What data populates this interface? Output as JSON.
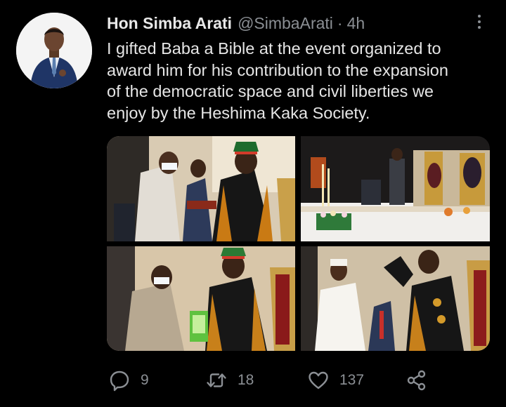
{
  "tweet": {
    "author_name": "Hon Simba Arati",
    "handle": "@SimbaArati",
    "separator": "·",
    "time": "4h",
    "text_lines": [
      "I gifted Baba a Bible at the event organized to",
      "award him for his contribution to the expansion",
      "of the democratic space and civil liberties we",
      "enjoy by the Heshima Kaka Society."
    ]
  },
  "media": {
    "photo_count": 4
  },
  "actions": {
    "reply": {
      "icon": "reply-icon",
      "count": "9"
    },
    "retweet": {
      "icon": "retweet-icon",
      "count": "18"
    },
    "like": {
      "icon": "heart-icon",
      "count": "137"
    },
    "share": {
      "icon": "share-icon"
    }
  },
  "colors": {
    "background": "#000000",
    "primary_text": "#e6e6e6",
    "secondary_text": "#8b8f94"
  }
}
